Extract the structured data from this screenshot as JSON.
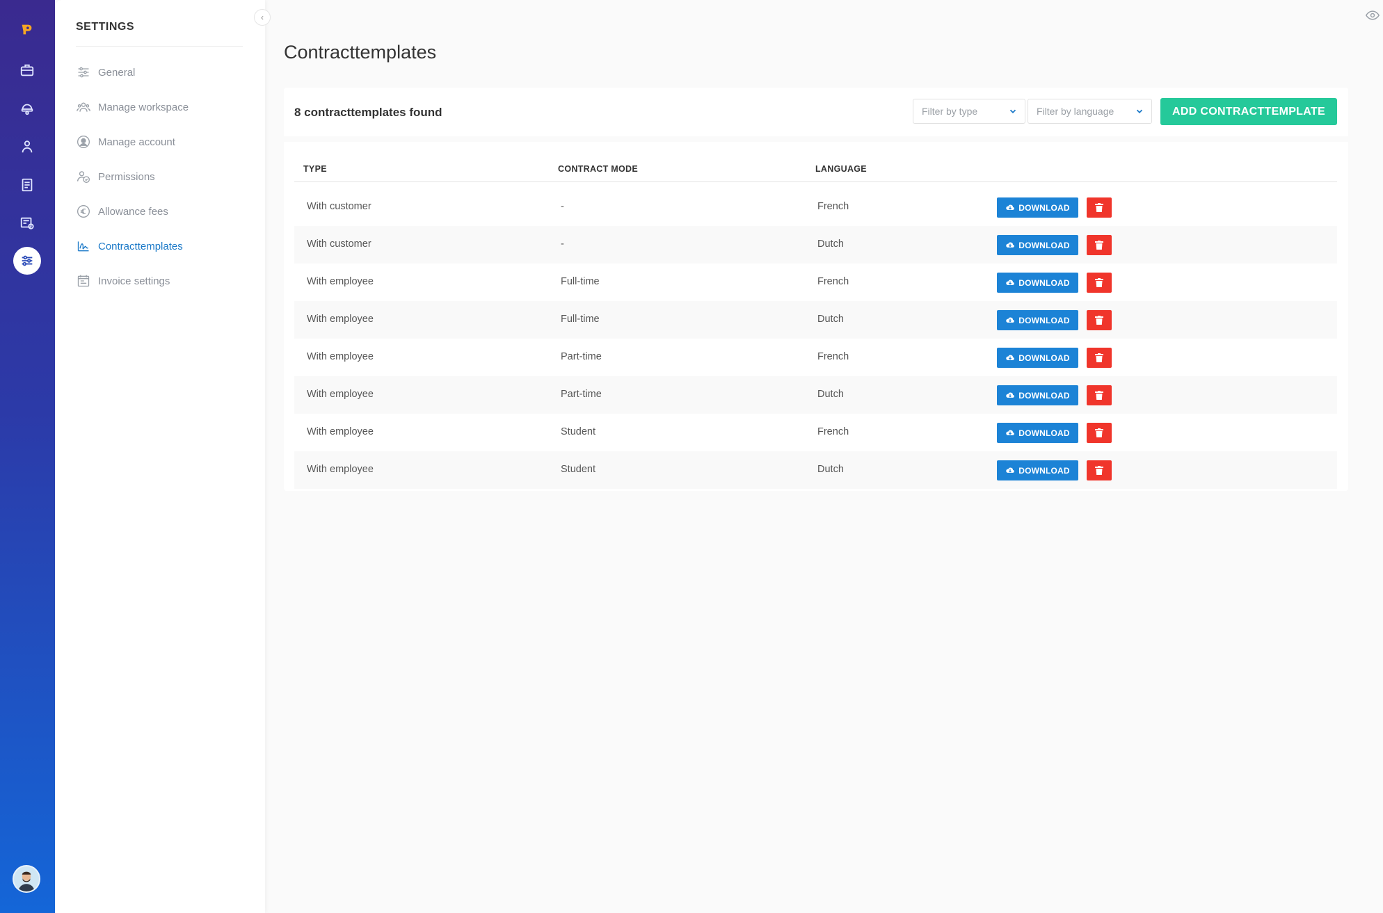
{
  "settings": {
    "title": "SETTINGS",
    "items": [
      {
        "label": "General",
        "icon": "sliders-icon",
        "active": false
      },
      {
        "label": "Manage workspace",
        "icon": "group-icon",
        "active": false
      },
      {
        "label": "Manage account",
        "icon": "user-circle-icon",
        "active": false
      },
      {
        "label": "Permissions",
        "icon": "user-check-icon",
        "active": false
      },
      {
        "label": "Allowance fees",
        "icon": "euro-icon",
        "active": false
      },
      {
        "label": "Contracttemplates",
        "icon": "signature-icon",
        "active": true
      },
      {
        "label": "Invoice settings",
        "icon": "invoice-icon",
        "active": false
      }
    ]
  },
  "page": {
    "title": "Contracttemplates",
    "found_count": "8 contracttemplates found",
    "filter_type_placeholder": "Filter by type",
    "filter_language_placeholder": "Filter by language",
    "add_button": "ADD CONTRACTTEMPLATE"
  },
  "table": {
    "headers": {
      "type": "TYPE",
      "contract_mode": "CONTRACT MODE",
      "language": "LANGUAGE"
    },
    "download_label": "DOWNLOAD",
    "rows": [
      {
        "type": "With customer",
        "contract_mode": "-",
        "language": "French"
      },
      {
        "type": "With customer",
        "contract_mode": "-",
        "language": "Dutch"
      },
      {
        "type": "With employee",
        "contract_mode": "Full-time",
        "language": "French"
      },
      {
        "type": "With employee",
        "contract_mode": "Full-time",
        "language": "Dutch"
      },
      {
        "type": "With employee",
        "contract_mode": "Part-time",
        "language": "French"
      },
      {
        "type": "With employee",
        "contract_mode": "Part-time",
        "language": "Dutch"
      },
      {
        "type": "With employee",
        "contract_mode": "Student",
        "language": "French"
      },
      {
        "type": "With employee",
        "contract_mode": "Student",
        "language": "Dutch"
      }
    ]
  },
  "colors": {
    "accent_blue": "#1c83d6",
    "add_green": "#25c99a",
    "delete_red": "#f0352b",
    "rail_top": "#3a2a8f",
    "rail_bottom": "#1466d8"
  }
}
